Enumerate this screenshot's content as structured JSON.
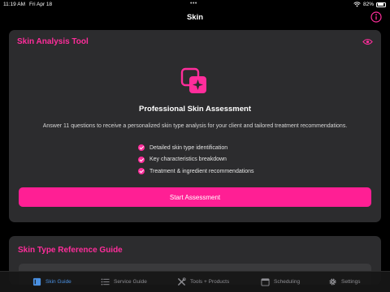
{
  "status": {
    "time": "11:19 AM",
    "date": "Fri Apr 18",
    "battery": "82%",
    "battery_level": 0.82
  },
  "nav": {
    "title": "Skin"
  },
  "colors": {
    "accent": "#ff2d9b",
    "button": "#ff1f94",
    "tab_active": "#4a90e2"
  },
  "analysis": {
    "title": "Skin Analysis Tool",
    "heading": "Professional Skin Assessment",
    "description": "Answer 11 questions to receive a personalized skin type analysis for your client and tailored treatment recommendations.",
    "features": [
      "Detailed skin type identification",
      "Key characteristics breakdown",
      "Treatment & ingredient recommendations"
    ],
    "button_label": "Start Assessment"
  },
  "reference": {
    "title": "Skin Type Reference Guide"
  },
  "tabs": [
    {
      "label": "Skin Guide",
      "icon": "book-icon",
      "active": true
    },
    {
      "label": "Service Guide",
      "icon": "list-icon",
      "active": false
    },
    {
      "label": "Tools + Products",
      "icon": "tools-icon",
      "active": false
    },
    {
      "label": "Scheduling",
      "icon": "calendar-icon",
      "active": false
    },
    {
      "label": "Settings",
      "icon": "gear-icon",
      "active": false
    }
  ]
}
